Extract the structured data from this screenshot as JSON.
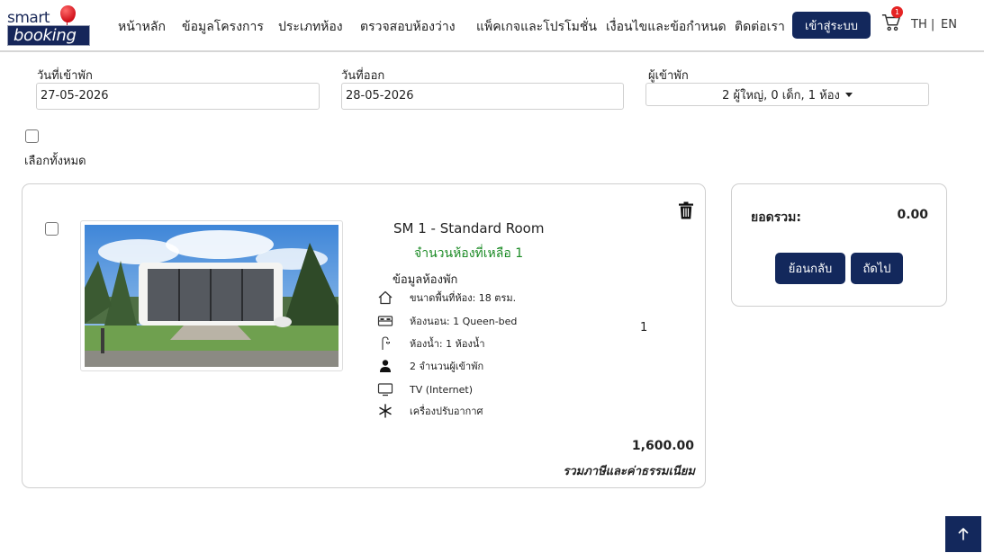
{
  "brand": {
    "logo_top": "smart",
    "logo_bottom": "booking"
  },
  "nav": {
    "items": [
      {
        "label": "หน้าหลัก"
      },
      {
        "label": "ข้อมูลโครงการ"
      },
      {
        "label": "ประเภทห้อง"
      },
      {
        "label": "ตรวจสอบห้องว่าง"
      },
      {
        "label": "แพ็คเกจและโปรโมชั่น"
      },
      {
        "label": "เงื่อนไขและข้อกำหนด"
      },
      {
        "label": "ติดต่อเรา"
      }
    ],
    "login_label": "เข้าสู่ระบบ",
    "cart_icon": "cart-icon",
    "cart_count": "1",
    "lang_th": "TH |",
    "lang_en": "EN"
  },
  "search": {
    "checkin_label": "วันที่เข้าพัก",
    "checkin_value": "27-05-2026",
    "checkout_label": "วันที่ออก",
    "checkout_value": "28-05-2026",
    "guests_label": "ผู้เข้าพัก",
    "guests_value": "2 ผู้ใหญ่, 0 เด็ก, 1 ห้อง"
  },
  "select_all_label": "เลือกทั้งหมด",
  "room": {
    "title": "SM 1 - Standard Room",
    "rooms_left": "จำนวนห้องที่เหลือ 1",
    "info_heading": "ข้อมูลห้องพัก",
    "amenities": [
      {
        "icon": "house-icon",
        "text": "ขนาดพื้นที่ห้อง: 18 ตรม."
      },
      {
        "icon": "bed-icon",
        "text": "ห้องนอน: 1 Queen-bed"
      },
      {
        "icon": "shower-icon",
        "text": "ห้องน้ำ: 1 ห้องน้ำ"
      },
      {
        "icon": "person-icon",
        "text": "2 จำนวนผู้เข้าพัก"
      },
      {
        "icon": "tv-icon",
        "text": "TV (Internet)"
      },
      {
        "icon": "snowflake-icon",
        "text": "เครื่องปรับอากาศ"
      }
    ],
    "quantity": "1",
    "price": "1,600.00",
    "price_note": "รวมภาษีและค่าธรรมเนียม"
  },
  "summary": {
    "total_label": "ยอดรวม:",
    "total_value": "0.00",
    "back_label": "ย้อนกลับ",
    "next_label": "ถัดไป"
  },
  "scroll_top_icon": "arrow-up-icon",
  "colors": {
    "primary": "#13285c",
    "success": "#1a8a24",
    "badge": "#e52424"
  }
}
